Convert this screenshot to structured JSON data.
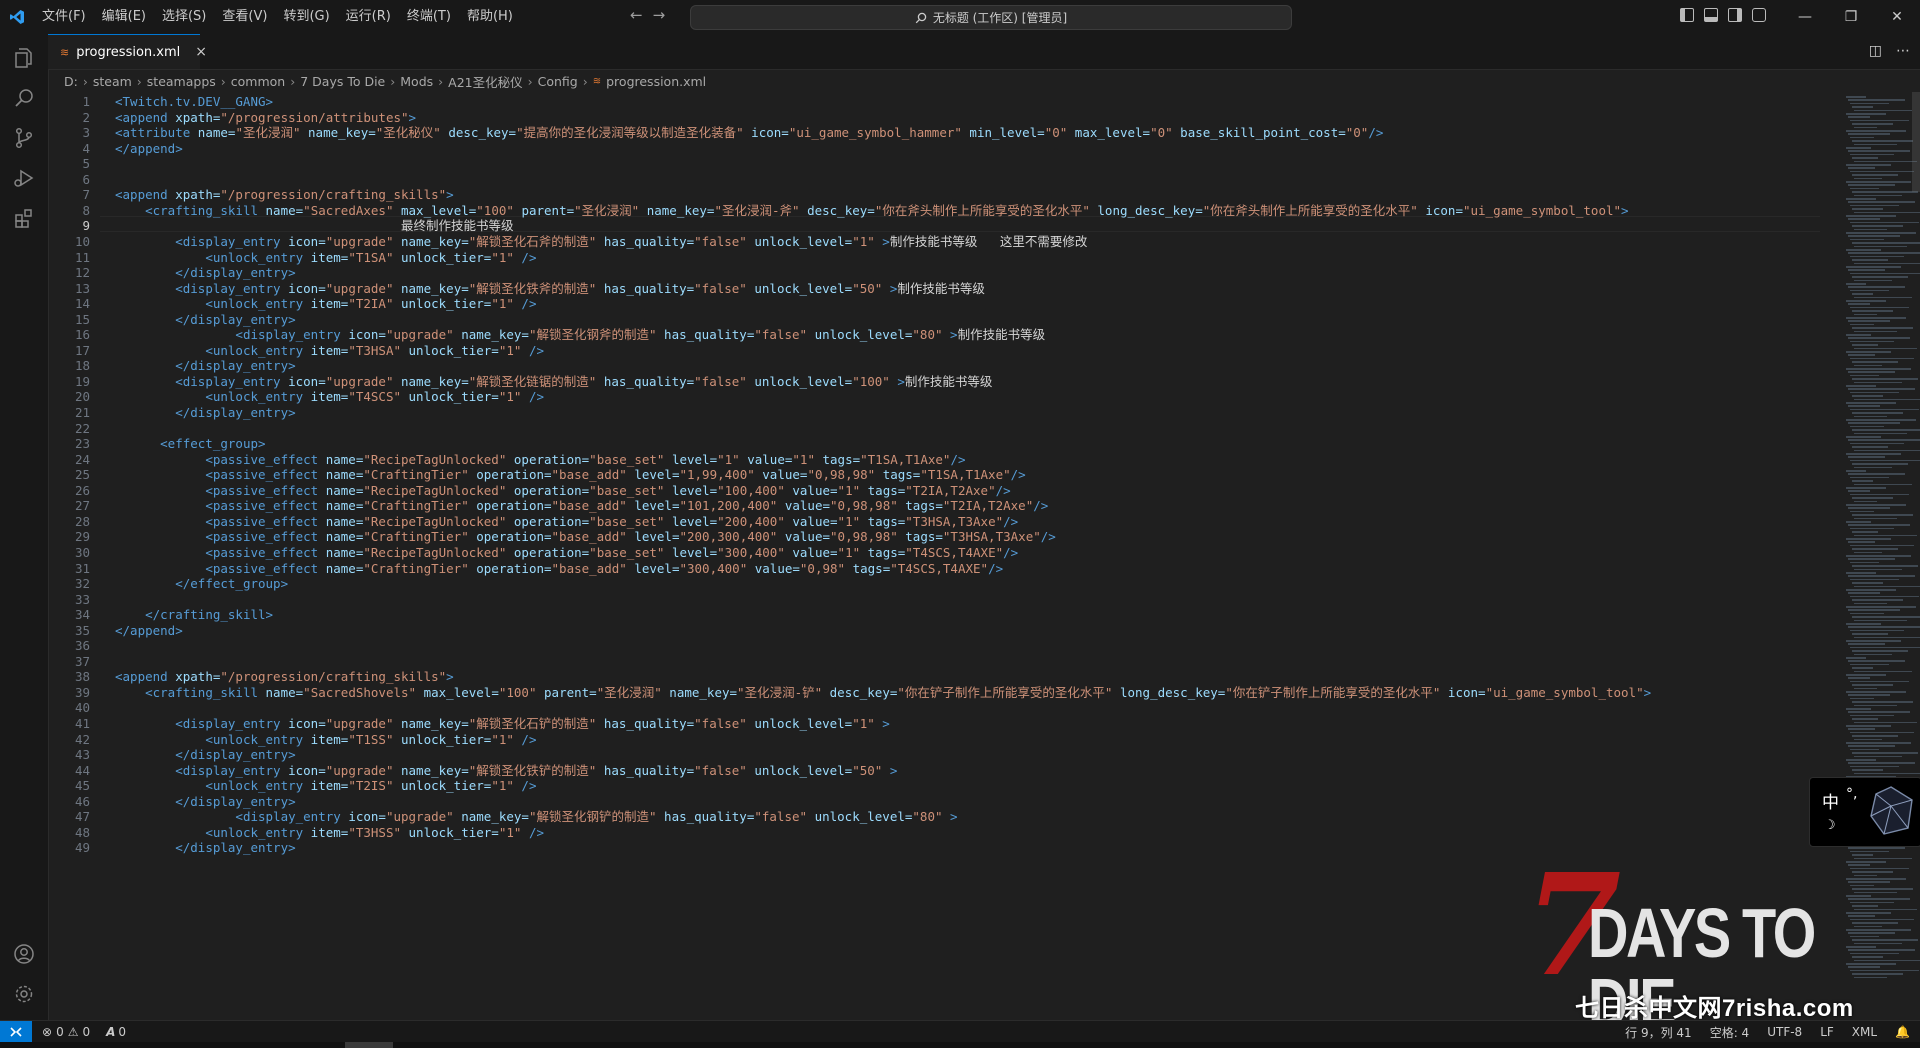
{
  "menu": [
    "文件(F)",
    "编辑(E)",
    "选择(S)",
    "查看(V)",
    "转到(G)",
    "运行(R)",
    "终端(T)",
    "帮助(H)"
  ],
  "command_center": "无标题 (工作区) [管理员]",
  "tab": {
    "label": "progression.xml",
    "close": "×"
  },
  "breadcrumb": [
    "D:",
    "steam",
    "steamapps",
    "common",
    "7 Days To Die",
    "Mods",
    "A21圣化秘仪",
    "Config",
    "progression.xml"
  ],
  "code_lines": [
    [
      [
        "t",
        "<Twitch.tv.DEV__GANG>"
      ]
    ],
    [
      [
        "t",
        "<append "
      ],
      [
        "a",
        "xpath="
      ],
      [
        "s",
        "\"/progression/attributes\""
      ],
      [
        "t",
        ">"
      ]
    ],
    [
      [
        "t",
        "<attribute "
      ],
      [
        "a",
        "name="
      ],
      [
        "s",
        "\"圣化浸润\""
      ],
      [
        "a",
        " name_key="
      ],
      [
        "s",
        "\"圣化秘仪\""
      ],
      [
        "a",
        " desc_key="
      ],
      [
        "s",
        "\"提高你的圣化浸润等级以制造圣化装备\""
      ],
      [
        "a",
        " icon="
      ],
      [
        "s",
        "\"ui_game_symbol_hammer\""
      ],
      [
        "a",
        " min_level="
      ],
      [
        "s",
        "\"0\""
      ],
      [
        "a",
        " max_level="
      ],
      [
        "s",
        "\"0\""
      ],
      [
        "a",
        " base_skill_point_cost="
      ],
      [
        "s",
        "\"0\""
      ],
      [
        "t",
        "/>"
      ]
    ],
    [
      [
        "t",
        "</append>"
      ]
    ],
    [],
    [],
    [
      [
        "t",
        "<append "
      ],
      [
        "a",
        "xpath="
      ],
      [
        "s",
        "\"/progression/crafting_skills\""
      ],
      [
        "t",
        ">"
      ]
    ],
    [
      [
        "x",
        "    "
      ],
      [
        "t",
        "<crafting_skill "
      ],
      [
        "a",
        "name="
      ],
      [
        "s",
        "\"SacredAxes\""
      ],
      [
        "a",
        " max_level="
      ],
      [
        "s",
        "\"100\""
      ],
      [
        "a",
        " parent="
      ],
      [
        "s",
        "\"圣化浸润\""
      ],
      [
        "a",
        " name_key="
      ],
      [
        "s",
        "\"圣化浸润-斧\""
      ],
      [
        "a",
        " desc_key="
      ],
      [
        "s",
        "\"你在斧头制作上所能享受的圣化水平\""
      ],
      [
        "a",
        " long_desc_key="
      ],
      [
        "s",
        "\"你在斧头制作上所能享受的圣化水平\""
      ],
      [
        "a",
        " icon="
      ],
      [
        "s",
        "\"ui_game_symbol_tool\""
      ],
      [
        "t",
        ">"
      ]
    ],
    [
      [
        "x",
        "                                      最终制作技能书等级"
      ]
    ],
    [
      [
        "x",
        "        "
      ],
      [
        "t",
        "<display_entry "
      ],
      [
        "a",
        "icon="
      ],
      [
        "s",
        "\"upgrade\""
      ],
      [
        "a",
        " name_key="
      ],
      [
        "s",
        "\"解锁圣化石斧的制造\""
      ],
      [
        "a",
        " has_quality="
      ],
      [
        "s",
        "\"false\""
      ],
      [
        "a",
        " unlock_level="
      ],
      [
        "s",
        "\"1\""
      ],
      [
        "t",
        " >"
      ],
      [
        "x",
        "制作技能书等级   这里不需要修改"
      ]
    ],
    [
      [
        "x",
        "            "
      ],
      [
        "t",
        "<unlock_entry "
      ],
      [
        "a",
        "item="
      ],
      [
        "s",
        "\"T1SA\""
      ],
      [
        "a",
        " unlock_tier="
      ],
      [
        "s",
        "\"1\""
      ],
      [
        "t",
        " />"
      ]
    ],
    [
      [
        "x",
        "        "
      ],
      [
        "t",
        "</display_entry>"
      ]
    ],
    [
      [
        "x",
        "        "
      ],
      [
        "t",
        "<display_entry "
      ],
      [
        "a",
        "icon="
      ],
      [
        "s",
        "\"upgrade\""
      ],
      [
        "a",
        " name_key="
      ],
      [
        "s",
        "\"解锁圣化铁斧的制造\""
      ],
      [
        "a",
        " has_quality="
      ],
      [
        "s",
        "\"false\""
      ],
      [
        "a",
        " unlock_level="
      ],
      [
        "s",
        "\"50\""
      ],
      [
        "t",
        " >"
      ],
      [
        "x",
        "制作技能书等级"
      ]
    ],
    [
      [
        "x",
        "            "
      ],
      [
        "t",
        "<unlock_entry "
      ],
      [
        "a",
        "item="
      ],
      [
        "s",
        "\"T2IA\""
      ],
      [
        "a",
        " unlock_tier="
      ],
      [
        "s",
        "\"1\""
      ],
      [
        "t",
        " />"
      ]
    ],
    [
      [
        "x",
        "        "
      ],
      [
        "t",
        "</display_entry>"
      ]
    ],
    [
      [
        "x",
        "                "
      ],
      [
        "t",
        "<display_entry "
      ],
      [
        "a",
        "icon="
      ],
      [
        "s",
        "\"upgrade\""
      ],
      [
        "a",
        " name_key="
      ],
      [
        "s",
        "\"解锁圣化钢斧的制造\""
      ],
      [
        "a",
        " has_quality="
      ],
      [
        "s",
        "\"false\""
      ],
      [
        "a",
        " unlock_level="
      ],
      [
        "s",
        "\"80\""
      ],
      [
        "t",
        " >"
      ],
      [
        "x",
        "制作技能书等级"
      ]
    ],
    [
      [
        "x",
        "            "
      ],
      [
        "t",
        "<unlock_entry "
      ],
      [
        "a",
        "item="
      ],
      [
        "s",
        "\"T3HSA\""
      ],
      [
        "a",
        " unlock_tier="
      ],
      [
        "s",
        "\"1\""
      ],
      [
        "t",
        " />"
      ]
    ],
    [
      [
        "x",
        "        "
      ],
      [
        "t",
        "</display_entry>"
      ]
    ],
    [
      [
        "x",
        "        "
      ],
      [
        "t",
        "<display_entry "
      ],
      [
        "a",
        "icon="
      ],
      [
        "s",
        "\"upgrade\""
      ],
      [
        "a",
        " name_key="
      ],
      [
        "s",
        "\"解锁圣化链锯的制造\""
      ],
      [
        "a",
        " has_quality="
      ],
      [
        "s",
        "\"false\""
      ],
      [
        "a",
        " unlock_level="
      ],
      [
        "s",
        "\"100\""
      ],
      [
        "t",
        " >"
      ],
      [
        "x",
        "制作技能书等级"
      ]
    ],
    [
      [
        "x",
        "            "
      ],
      [
        "t",
        "<unlock_entry "
      ],
      [
        "a",
        "item="
      ],
      [
        "s",
        "\"T4SCS\""
      ],
      [
        "a",
        " unlock_tier="
      ],
      [
        "s",
        "\"1\""
      ],
      [
        "t",
        " />"
      ]
    ],
    [
      [
        "x",
        "        "
      ],
      [
        "t",
        "</display_entry>"
      ]
    ],
    [],
    [
      [
        "x",
        "      "
      ],
      [
        "t",
        "<effect_group>"
      ]
    ],
    [
      [
        "x",
        "            "
      ],
      [
        "t",
        "<passive_effect "
      ],
      [
        "a",
        "name="
      ],
      [
        "s",
        "\"RecipeTagUnlocked\""
      ],
      [
        "a",
        " operation="
      ],
      [
        "s",
        "\"base_set\""
      ],
      [
        "a",
        " level="
      ],
      [
        "s",
        "\"1\""
      ],
      [
        "a",
        " value="
      ],
      [
        "s",
        "\"1\""
      ],
      [
        "a",
        " tags="
      ],
      [
        "s",
        "\"T1SA,T1Axe\""
      ],
      [
        "t",
        "/>"
      ]
    ],
    [
      [
        "x",
        "            "
      ],
      [
        "t",
        "<passive_effect "
      ],
      [
        "a",
        "name="
      ],
      [
        "s",
        "\"CraftingTier\""
      ],
      [
        "a",
        " operation="
      ],
      [
        "s",
        "\"base_add\""
      ],
      [
        "a",
        " level="
      ],
      [
        "s",
        "\"1,99,400\""
      ],
      [
        "a",
        " value="
      ],
      [
        "s",
        "\"0,98,98\""
      ],
      [
        "a",
        " tags="
      ],
      [
        "s",
        "\"T1SA,T1Axe\""
      ],
      [
        "t",
        "/>"
      ]
    ],
    [
      [
        "x",
        "            "
      ],
      [
        "t",
        "<passive_effect "
      ],
      [
        "a",
        "name="
      ],
      [
        "s",
        "\"RecipeTagUnlocked\""
      ],
      [
        "a",
        " operation="
      ],
      [
        "s",
        "\"base_set\""
      ],
      [
        "a",
        " level="
      ],
      [
        "s",
        "\"100,400\""
      ],
      [
        "a",
        " value="
      ],
      [
        "s",
        "\"1\""
      ],
      [
        "a",
        " tags="
      ],
      [
        "s",
        "\"T2IA,T2Axe\""
      ],
      [
        "t",
        "/>"
      ]
    ],
    [
      [
        "x",
        "            "
      ],
      [
        "t",
        "<passive_effect "
      ],
      [
        "a",
        "name="
      ],
      [
        "s",
        "\"CraftingTier\""
      ],
      [
        "a",
        " operation="
      ],
      [
        "s",
        "\"base_add\""
      ],
      [
        "a",
        " level="
      ],
      [
        "s",
        "\"101,200,400\""
      ],
      [
        "a",
        " value="
      ],
      [
        "s",
        "\"0,98,98\""
      ],
      [
        "a",
        " tags="
      ],
      [
        "s",
        "\"T2IA,T2Axe\""
      ],
      [
        "t",
        "/>"
      ]
    ],
    [
      [
        "x",
        "            "
      ],
      [
        "t",
        "<passive_effect "
      ],
      [
        "a",
        "name="
      ],
      [
        "s",
        "\"RecipeTagUnlocked\""
      ],
      [
        "a",
        " operation="
      ],
      [
        "s",
        "\"base_set\""
      ],
      [
        "a",
        " level="
      ],
      [
        "s",
        "\"200,400\""
      ],
      [
        "a",
        " value="
      ],
      [
        "s",
        "\"1\""
      ],
      [
        "a",
        " tags="
      ],
      [
        "s",
        "\"T3HSA,T3Axe\""
      ],
      [
        "t",
        "/>"
      ]
    ],
    [
      [
        "x",
        "            "
      ],
      [
        "t",
        "<passive_effect "
      ],
      [
        "a",
        "name="
      ],
      [
        "s",
        "\"CraftingTier\""
      ],
      [
        "a",
        " operation="
      ],
      [
        "s",
        "\"base_add\""
      ],
      [
        "a",
        " level="
      ],
      [
        "s",
        "\"200,300,400\""
      ],
      [
        "a",
        " value="
      ],
      [
        "s",
        "\"0,98,98\""
      ],
      [
        "a",
        " tags="
      ],
      [
        "s",
        "\"T3HSA,T3Axe\""
      ],
      [
        "t",
        "/>"
      ]
    ],
    [
      [
        "x",
        "            "
      ],
      [
        "t",
        "<passive_effect "
      ],
      [
        "a",
        "name="
      ],
      [
        "s",
        "\"RecipeTagUnlocked\""
      ],
      [
        "a",
        " operation="
      ],
      [
        "s",
        "\"base_set\""
      ],
      [
        "a",
        " level="
      ],
      [
        "s",
        "\"300,400\""
      ],
      [
        "a",
        " value="
      ],
      [
        "s",
        "\"1\""
      ],
      [
        "a",
        " tags="
      ],
      [
        "s",
        "\"T4SCS,T4AXE\""
      ],
      [
        "t",
        "/>"
      ]
    ],
    [
      [
        "x",
        "            "
      ],
      [
        "t",
        "<passive_effect "
      ],
      [
        "a",
        "name="
      ],
      [
        "s",
        "\"CraftingTier\""
      ],
      [
        "a",
        " operation="
      ],
      [
        "s",
        "\"base_add\""
      ],
      [
        "a",
        " level="
      ],
      [
        "s",
        "\"300,400\""
      ],
      [
        "a",
        " value="
      ],
      [
        "s",
        "\"0,98\""
      ],
      [
        "a",
        " tags="
      ],
      [
        "s",
        "\"T4SCS,T4AXE\""
      ],
      [
        "t",
        "/>"
      ]
    ],
    [
      [
        "x",
        "        "
      ],
      [
        "t",
        "</effect_group>"
      ]
    ],
    [],
    [
      [
        "x",
        "    "
      ],
      [
        "t",
        "</crafting_skill>"
      ]
    ],
    [
      [
        "t",
        "</append>"
      ]
    ],
    [],
    [],
    [
      [
        "t",
        "<append "
      ],
      [
        "a",
        "xpath="
      ],
      [
        "s",
        "\"/progression/crafting_skills\""
      ],
      [
        "t",
        ">"
      ]
    ],
    [
      [
        "x",
        "    "
      ],
      [
        "t",
        "<crafting_skill "
      ],
      [
        "a",
        "name="
      ],
      [
        "s",
        "\"SacredShovels\""
      ],
      [
        "a",
        " max_level="
      ],
      [
        "s",
        "\"100\""
      ],
      [
        "a",
        " parent="
      ],
      [
        "s",
        "\"圣化浸润\""
      ],
      [
        "a",
        " name_key="
      ],
      [
        "s",
        "\"圣化浸润-铲\""
      ],
      [
        "a",
        " desc_key="
      ],
      [
        "s",
        "\"你在铲子制作上所能享受的圣化水平\""
      ],
      [
        "a",
        " long_desc_key="
      ],
      [
        "s",
        "\"你在铲子制作上所能享受的圣化水平\""
      ],
      [
        "a",
        " icon="
      ],
      [
        "s",
        "\"ui_game_symbol_tool\""
      ],
      [
        "t",
        ">"
      ]
    ],
    [],
    [
      [
        "x",
        "        "
      ],
      [
        "t",
        "<display_entry "
      ],
      [
        "a",
        "icon="
      ],
      [
        "s",
        "\"upgrade\""
      ],
      [
        "a",
        " name_key="
      ],
      [
        "s",
        "\"解锁圣化石铲的制造\""
      ],
      [
        "a",
        " has_quality="
      ],
      [
        "s",
        "\"false\""
      ],
      [
        "a",
        " unlock_level="
      ],
      [
        "s",
        "\"1\""
      ],
      [
        "t",
        " >"
      ]
    ],
    [
      [
        "x",
        "            "
      ],
      [
        "t",
        "<unlock_entry "
      ],
      [
        "a",
        "item="
      ],
      [
        "s",
        "\"T1SS\""
      ],
      [
        "a",
        " unlock_tier="
      ],
      [
        "s",
        "\"1\""
      ],
      [
        "t",
        " />"
      ]
    ],
    [
      [
        "x",
        "        "
      ],
      [
        "t",
        "</display_entry>"
      ]
    ],
    [
      [
        "x",
        "        "
      ],
      [
        "t",
        "<display_entry "
      ],
      [
        "a",
        "icon="
      ],
      [
        "s",
        "\"upgrade\""
      ],
      [
        "a",
        " name_key="
      ],
      [
        "s",
        "\"解锁圣化铁铲的制造\""
      ],
      [
        "a",
        " has_quality="
      ],
      [
        "s",
        "\"false\""
      ],
      [
        "a",
        " unlock_level="
      ],
      [
        "s",
        "\"50\""
      ],
      [
        "t",
        " >"
      ]
    ],
    [
      [
        "x",
        "            "
      ],
      [
        "t",
        "<unlock_entry "
      ],
      [
        "a",
        "item="
      ],
      [
        "s",
        "\"T2IS\""
      ],
      [
        "a",
        " unlock_tier="
      ],
      [
        "s",
        "\"1\""
      ],
      [
        "t",
        " />"
      ]
    ],
    [
      [
        "x",
        "        "
      ],
      [
        "t",
        "</display_entry>"
      ]
    ],
    [
      [
        "x",
        "                "
      ],
      [
        "t",
        "<display_entry "
      ],
      [
        "a",
        "icon="
      ],
      [
        "s",
        "\"upgrade\""
      ],
      [
        "a",
        " name_key="
      ],
      [
        "s",
        "\"解锁圣化钢铲的制造\""
      ],
      [
        "a",
        " has_quality="
      ],
      [
        "s",
        "\"false\""
      ],
      [
        "a",
        " unlock_level="
      ],
      [
        "s",
        "\"80\""
      ],
      [
        "t",
        " >"
      ]
    ],
    [
      [
        "x",
        "            "
      ],
      [
        "t",
        "<unlock_entry "
      ],
      [
        "a",
        "item="
      ],
      [
        "s",
        "\"T3HSS\""
      ],
      [
        "a",
        " unlock_tier="
      ],
      [
        "s",
        "\"1\""
      ],
      [
        "t",
        " />"
      ]
    ],
    [
      [
        "x",
        "        "
      ],
      [
        "t",
        "</display_entry>"
      ]
    ]
  ],
  "current_line": 9,
  "ime": {
    "lang": "中",
    "punct": "°,"
  },
  "watermark": {
    "title": "DAYS TO DIE",
    "numeral": "7",
    "site": "七日杀中文网7risha.com"
  },
  "status": {
    "errors": "0",
    "warnings": "0",
    "ports": "0",
    "cursor": "行 9，列 41",
    "spaces": "空格: 4",
    "encoding": "UTF-8",
    "eol": "LF",
    "language": "XML"
  },
  "colors": {
    "accent": "#0078d4",
    "tag": "#569cd6",
    "attr": "#9cdcfe",
    "string": "#ce9178",
    "text": "#d4d4d4"
  }
}
